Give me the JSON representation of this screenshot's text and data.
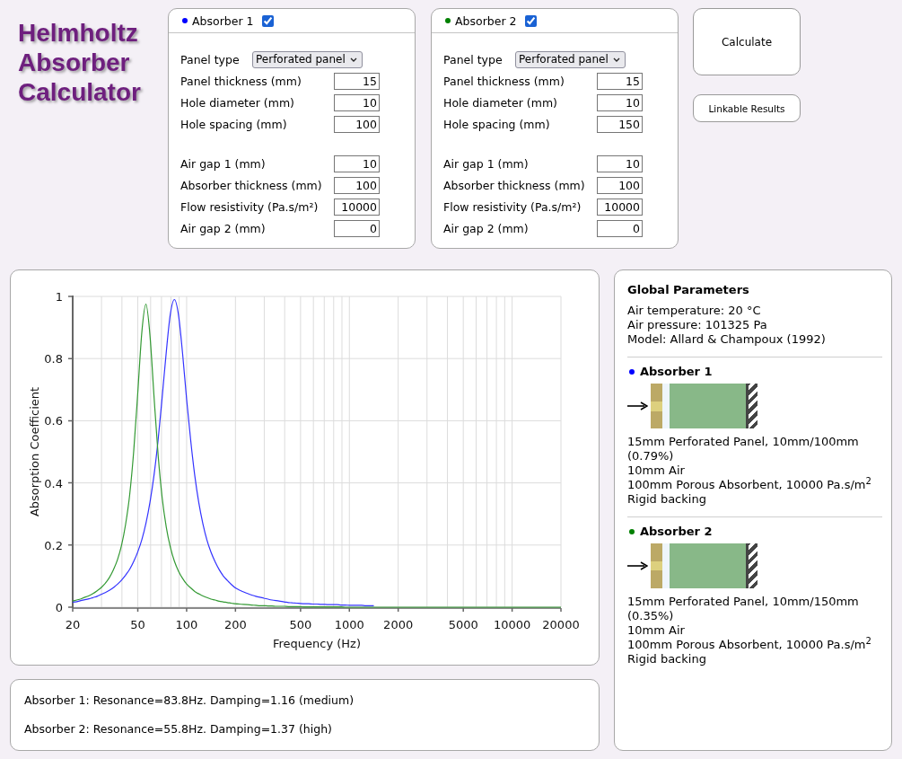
{
  "title": "Helmholtz Absorber Calculator",
  "absorbers": [
    {
      "label": "Absorber 1",
      "color": "#0000ff",
      "checked": true,
      "panel_type": {
        "label": "Panel type",
        "value": "Perforated panel"
      },
      "panel_fields": [
        {
          "label": "Panel thickness (mm)",
          "value": "15"
        },
        {
          "label": "Hole diameter (mm)",
          "value": "10"
        },
        {
          "label": "Hole spacing (mm)",
          "value": "100"
        }
      ],
      "cavity_fields": [
        {
          "label": "Air gap 1 (mm)",
          "value": "10"
        },
        {
          "label": "Absorber thickness (mm)",
          "value": "100"
        },
        {
          "label": "Flow resistivity (Pa.s/m²)",
          "value": "10000"
        },
        {
          "label": "Air gap 2 (mm)",
          "value": "0"
        }
      ]
    },
    {
      "label": "Absorber 2",
      "color": "#008000",
      "checked": true,
      "panel_type": {
        "label": "Panel type",
        "value": "Perforated panel"
      },
      "panel_fields": [
        {
          "label": "Panel thickness (mm)",
          "value": "15"
        },
        {
          "label": "Hole diameter (mm)",
          "value": "10"
        },
        {
          "label": "Hole spacing (mm)",
          "value": "150"
        }
      ],
      "cavity_fields": [
        {
          "label": "Air gap 1 (mm)",
          "value": "10"
        },
        {
          "label": "Absorber thickness (mm)",
          "value": "100"
        },
        {
          "label": "Flow resistivity (Pa.s/m²)",
          "value": "10000"
        },
        {
          "label": "Air gap 2 (mm)",
          "value": "0"
        }
      ]
    }
  ],
  "buttons": [
    {
      "label": "Calculate",
      "kind": "primary"
    },
    {
      "label": "Linkable Results",
      "kind": "secondary"
    }
  ],
  "chart": {
    "chart_data": {
      "type": "line",
      "xlabel": "Frequency (Hz)",
      "ylabel": "Absorption Coefficient",
      "grid": true,
      "categories": [
        "20",
        null,
        null,
        null,
        null,
        null,
        null,
        null,
        null,
        null,
        null,
        null,
        null,
        null,
        null,
        null,
        "50",
        null,
        null,
        null,
        null,
        null,
        null,
        null,
        null,
        null,
        null,
        null,
        "100",
        null,
        null,
        null,
        null,
        null,
        null,
        null,
        null,
        null,
        null,
        null,
        "200",
        null,
        null,
        null,
        null,
        null,
        null,
        null,
        null,
        null,
        null,
        null,
        null,
        null,
        null,
        null,
        "500",
        null,
        null,
        null,
        null,
        null,
        null,
        null,
        null,
        null,
        null,
        null,
        "1000",
        null,
        null,
        null,
        null,
        null,
        null,
        null,
        null,
        null,
        null,
        null,
        "2000",
        null,
        null,
        null,
        null,
        null,
        null,
        null,
        null,
        null,
        null,
        null,
        null,
        null,
        null,
        null,
        "5000",
        null,
        null,
        null,
        null,
        null,
        null,
        null,
        null,
        null,
        null,
        null,
        "10000",
        null,
        null,
        null,
        null,
        null,
        null,
        null,
        null,
        null,
        null,
        null,
        "20000"
      ],
      "series": [
        {
          "color": "#3333ff",
          "values": [
            0.016,
            0.018,
            0.021,
            0.024,
            0.027,
            0.031,
            0.035,
            0.041,
            0.047,
            0.054,
            0.063,
            0.074,
            0.087,
            0.103,
            0.122,
            0.147,
            0.178,
            0.218,
            0.27,
            0.338,
            0.427,
            0.539,
            0.676,
            0.822,
            0.943,
            0.99,
            0.94,
            0.817,
            0.67,
            0.536,
            0.424,
            0.336,
            0.268,
            0.216,
            0.177,
            0.146,
            0.121,
            0.101,
            0.086,
            0.073,
            0.062,
            0.055,
            0.049,
            0.044,
            0.039,
            0.035,
            0.032,
            0.029,
            0.026,
            0.023,
            0.021,
            0.019,
            0.017,
            0.015,
            0.014,
            0.013,
            0.012,
            0.011,
            0.011,
            0.01,
            0.01,
            0.009,
            0.009,
            0.008,
            0.008,
            0.008,
            0.007,
            0.007,
            0.006,
            0.006,
            0.006,
            0.006,
            0.005,
            0.005,
            0.005,
            null,
            null,
            null,
            null,
            null,
            null,
            null,
            null,
            null,
            null,
            null,
            null,
            null,
            null,
            null,
            null,
            null,
            null,
            null,
            null,
            null,
            null,
            null,
            null,
            null,
            null,
            null,
            null,
            null,
            null,
            null,
            null,
            null,
            null,
            null,
            null,
            null,
            null,
            null,
            null,
            null,
            null,
            null,
            null,
            null,
            null
          ]
        },
        {
          "color": "#339933",
          "values": [
            0.02,
            0.023,
            0.027,
            0.032,
            0.037,
            0.044,
            0.053,
            0.063,
            0.077,
            0.095,
            0.12,
            0.153,
            0.199,
            0.266,
            0.362,
            0.503,
            0.69,
            0.887,
            0.975,
            0.874,
            0.674,
            0.489,
            0.352,
            0.257,
            0.193,
            0.148,
            0.116,
            0.093,
            0.075,
            0.062,
            0.051,
            0.043,
            0.036,
            0.031,
            0.026,
            0.023,
            0.019,
            0.017,
            0.015,
            0.013,
            0.011,
            0.01,
            0.009,
            0.008,
            0.007,
            0.006,
            0.005,
            0.005,
            0.004,
            0.004,
            0.003,
            0.003,
            0.003,
            0.002,
            0.002,
            0.002,
            0.002,
            0.001,
            0.001,
            0.001,
            0.001,
            0.001,
            0.001,
            0.001,
            0.001,
            0.001,
            0.001,
            0,
            0,
            0,
            0,
            0,
            0,
            0,
            0,
            0,
            0,
            0,
            0,
            0,
            0,
            0,
            0,
            0,
            0,
            0,
            0,
            0,
            0,
            0,
            0,
            0,
            0,
            0,
            0,
            0,
            0,
            0,
            0,
            0,
            0,
            0,
            0,
            0,
            0,
            0,
            0,
            0,
            0,
            0,
            0,
            0,
            0,
            0,
            0,
            0,
            0,
            0,
            0,
            0,
            0
          ]
        }
      ],
      "ylim": [
        0,
        1
      ],
      "yticks": [
        0,
        0.2,
        0.4,
        0.6,
        0.8,
        1
      ]
    }
  },
  "results": [
    "Absorber 1: Resonance=83.8Hz. Damping=1.16 (medium)",
    "Absorber 2: Resonance=55.8Hz. Damping=1.37 (high)"
  ],
  "global_parameters": {
    "heading": "Global Parameters",
    "lines": [
      "Air temperature: 20 °C",
      "Air pressure: 101325 Pa",
      "Model: Allard & Champoux (1992)"
    ]
  },
  "summaries": [
    {
      "label": "Absorber 1",
      "color": "#0000ff",
      "layers": [
        {
          "kind": "panel"
        },
        {
          "kind": "air"
        },
        {
          "kind": "porous"
        },
        {
          "kind": "backing"
        }
      ],
      "description": [
        "15mm Perforated Panel, 10mm/100mm (0.79%)",
        "10mm Air",
        "100mm Porous Absorbent, 10000 Pa.s/m$^{2}$",
        "Rigid backing"
      ]
    },
    {
      "label": "Absorber 2",
      "color": "#008000",
      "layers": [
        {
          "kind": "panel"
        },
        {
          "kind": "air"
        },
        {
          "kind": "porous"
        },
        {
          "kind": "backing"
        }
      ],
      "description": [
        "15mm Perforated Panel, 10mm/150mm (0.35%)",
        "10mm Air",
        "100mm Porous Absorbent, 10000 Pa.s/m$^{2}$",
        "Rigid backing"
      ]
    }
  ]
}
